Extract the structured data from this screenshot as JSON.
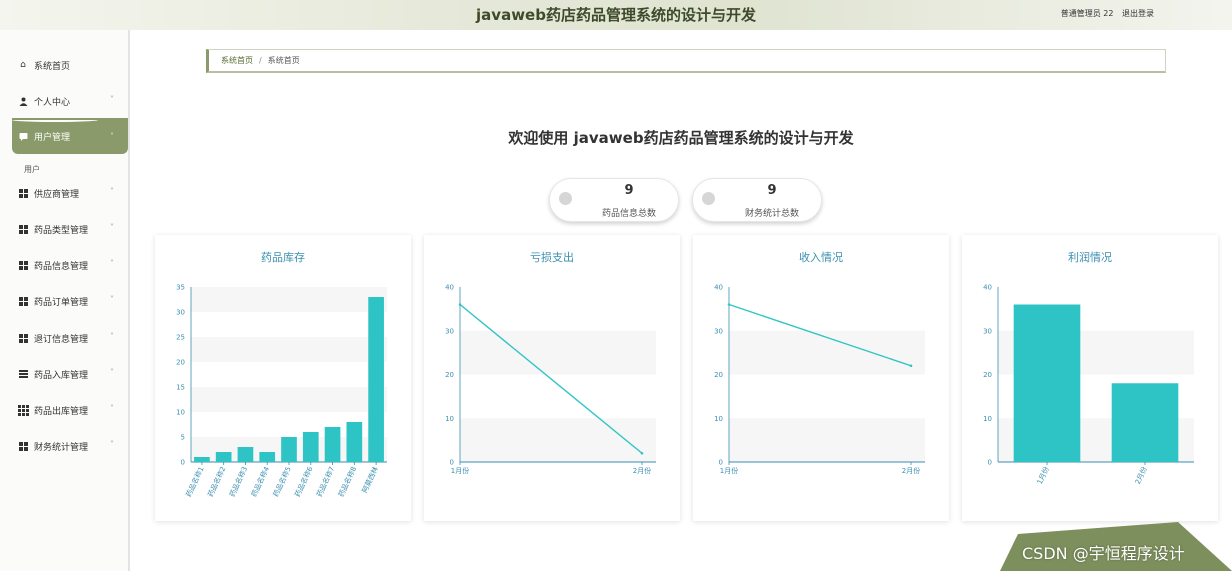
{
  "header": {
    "title": "javaweb药店药品管理系统的设计与开发",
    "user_label": "普通管理员 22",
    "logout_label": "退出登录"
  },
  "sidebar": {
    "items": [
      {
        "label": "系统首页",
        "icon": "home-icon"
      },
      {
        "label": "个人中心",
        "icon": "user-icon"
      },
      {
        "label": "用户管理",
        "icon": "chat-icon",
        "active": true
      },
      {
        "label": "供应商管理",
        "icon": "grid-icon"
      },
      {
        "label": "药品类型管理",
        "icon": "grid-icon"
      },
      {
        "label": "药品信息管理",
        "icon": "grid-icon"
      },
      {
        "label": "药品订单管理",
        "icon": "grid-icon"
      },
      {
        "label": "退订信息管理",
        "icon": "grid-icon"
      },
      {
        "label": "药品入库管理",
        "icon": "list-icon"
      },
      {
        "label": "药品出库管理",
        "icon": "grid9-icon"
      },
      {
        "label": "财务统计管理",
        "icon": "grid-icon"
      }
    ],
    "submenu": [
      "用户"
    ]
  },
  "breadcrumb": {
    "home": "系统首页",
    "current": "系统首页"
  },
  "welcome": "欢迎使用 javaweb药店药品管理系统的设计与开发",
  "stats": [
    {
      "value": "9",
      "label": "药品信息总数"
    },
    {
      "value": "9",
      "label": "财务统计总数"
    }
  ],
  "colors": {
    "accent": "#8a9a6a",
    "series": "#2ec4c6",
    "axis": "#3b8fb0",
    "title": "#3e4a2a"
  },
  "chart_data": [
    {
      "type": "bar",
      "title": "药品库存",
      "categories": [
        "药品名称1",
        "药品名称2",
        "药品名称3",
        "药品名称4",
        "药品名称5",
        "药品名称6",
        "药品名称7",
        "药品名称8",
        "阿莫西林"
      ],
      "values": [
        1,
        2,
        3,
        2,
        5,
        6,
        7,
        8,
        33
      ],
      "ylim": [
        0,
        35
      ],
      "yticks": [
        0,
        5,
        10,
        15,
        20,
        25,
        30,
        35
      ],
      "grid": true
    },
    {
      "type": "line",
      "title": "亏损支出",
      "categories": [
        "1月份",
        "2月份"
      ],
      "values": [
        36,
        2
      ],
      "ylim": [
        0,
        40
      ],
      "yticks": [
        0,
        10,
        20,
        30,
        40
      ],
      "grid": true
    },
    {
      "type": "line",
      "title": "收入情况",
      "categories": [
        "1月份",
        "2月份"
      ],
      "values": [
        36,
        22
      ],
      "ylim": [
        0,
        40
      ],
      "yticks": [
        0,
        10,
        20,
        30,
        40
      ],
      "grid": true
    },
    {
      "type": "bar",
      "title": "利润情况",
      "categories": [
        "1月份",
        "2月份"
      ],
      "values": [
        36,
        18
      ],
      "ylim": [
        0,
        40
      ],
      "yticks": [
        0,
        10,
        20,
        30,
        40
      ],
      "grid": true
    }
  ],
  "watermark": "CSDN @宇恒程序设计"
}
